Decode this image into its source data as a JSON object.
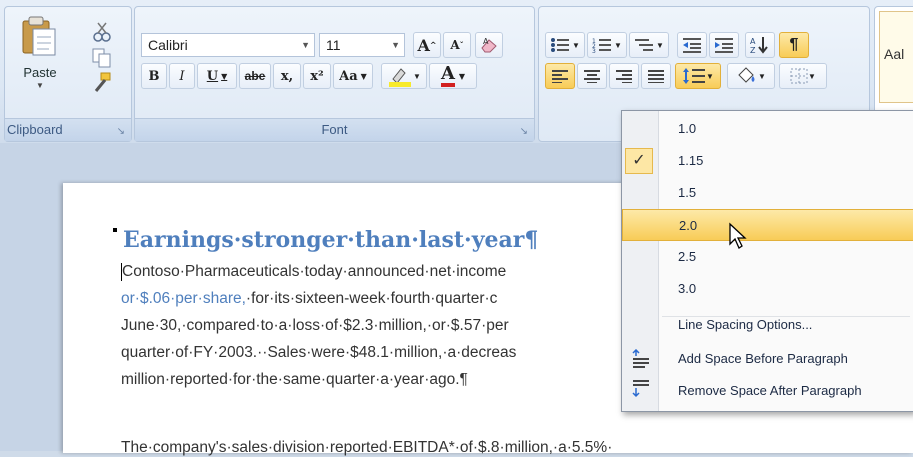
{
  "clipboard": {
    "paste_label": "Paste",
    "group_label": "Clipboard"
  },
  "font_group": {
    "font_name": "Calibri",
    "font_size": "11",
    "grow_label": "A",
    "shrink_label": "A",
    "bold": "B",
    "italic": "I",
    "underline": "U",
    "strike": "abe",
    "subscript": "x,",
    "superscript": "x²",
    "change_case": "Aa",
    "font_color_label": "A",
    "group_label": "Font"
  },
  "styles": {
    "preview_label": "Aal"
  },
  "document": {
    "heading": "Earnings·stronger·than·last·year¶",
    "lines": [
      {
        "parts": [
          {
            "t": "Contoso·Pharmaceuticals·today·announced·net·income",
            "blue": false
          }
        ]
      },
      {
        "parts": [
          {
            "t": "or·$.06·per·share,",
            "blue": true
          },
          {
            "t": "·for·its·sixteen-week·fourth·quarter·c",
            "blue": false
          }
        ]
      },
      {
        "parts": [
          {
            "t": "June·30,·compared·to·a·loss·of·$2.3·million,·or·$.57·per",
            "blue": false
          }
        ]
      },
      {
        "parts": [
          {
            "t": "quarter·of·FY·2003.··Sales·were·$48.1·million,·a·decreas",
            "blue": false
          }
        ]
      },
      {
        "parts": [
          {
            "t": "million·reported·for·the·same·quarter·a·year·ago.¶",
            "blue": false
          }
        ]
      }
    ],
    "second_para": "The·company's·sales·division·reported·EBITDA*·of·$.8·million,·a·5.5%·"
  },
  "line_spacing_menu": {
    "items": [
      {
        "label": "1.0",
        "checked": false,
        "highlighted": false
      },
      {
        "label": "1.15",
        "checked": true,
        "highlighted": false
      },
      {
        "label": "1.5",
        "checked": false,
        "highlighted": false
      },
      {
        "label": "2.0",
        "checked": false,
        "highlighted": true
      },
      {
        "label": "2.5",
        "checked": false,
        "highlighted": false
      },
      {
        "label": "3.0",
        "checked": false,
        "highlighted": false
      }
    ],
    "options_label": "Line Spacing Options...",
    "add_before_label": "Add Space Before Paragraph",
    "remove_after_label": "Remove Space After Paragraph",
    "check_glyph": "✓"
  },
  "colors": {
    "heading": "#4f7fbd",
    "highlight": "#f8cc57",
    "ribbon": "#dce7f4"
  }
}
